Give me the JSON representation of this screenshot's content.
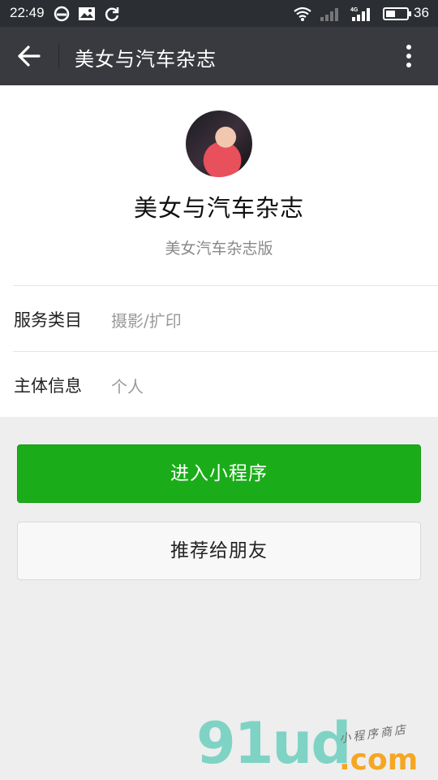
{
  "status_bar": {
    "time": "22:49",
    "battery_level": "36",
    "icons": [
      "clock-icon",
      "image-icon",
      "sync-icon",
      "wifi-icon",
      "signal-icon",
      "4g-signal-icon",
      "battery-icon"
    ]
  },
  "title_bar": {
    "title": "美女与汽车杂志",
    "back_icon": "arrow-left-icon",
    "more_icon": "more-vertical-icon"
  },
  "profile": {
    "name": "美女与汽车杂志",
    "description": "美女汽车杂志版"
  },
  "info_rows": [
    {
      "label": "服务类目",
      "value": "摄影/扩印"
    },
    {
      "label": "主体信息",
      "value": "个人"
    }
  ],
  "actions": {
    "enter_label": "进入小程序",
    "share_label": "推荐给朋友"
  },
  "watermark": {
    "logo": "91ud",
    "domain": ".com",
    "tagline": "小程序商店"
  },
  "colors": {
    "status_bar_bg": "#2b2e33",
    "title_bar_bg": "#393a3f",
    "primary_green": "#1aad19",
    "page_bg": "#eeeeee"
  }
}
